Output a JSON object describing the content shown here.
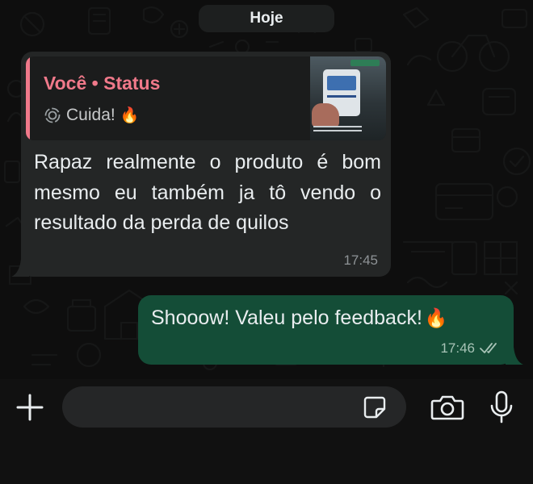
{
  "chat": {
    "date_label": "Hoje",
    "incoming": {
      "quote": {
        "author": "Você • Status",
        "text": "Cuida!",
        "emoji": "🔥"
      },
      "text": "Rapaz realmente o produto é bom mesmo eu também ja tô vendo o resultado da perda de quilos",
      "time": "17:45"
    },
    "outgoing": {
      "text": "Shooow! Valeu pelo feedback!",
      "emoji": "🔥",
      "time": "17:46",
      "status": "read"
    }
  },
  "input_bar": {
    "message_value": "",
    "icons": [
      "plus-icon",
      "sticker-icon",
      "camera-icon",
      "microphone-icon"
    ]
  },
  "colors": {
    "background": "#0e0e0e",
    "incoming_bubble": "#242626",
    "outgoing_bubble": "#144d37",
    "quote_accent": "#f0798a",
    "input_field": "#252627"
  }
}
